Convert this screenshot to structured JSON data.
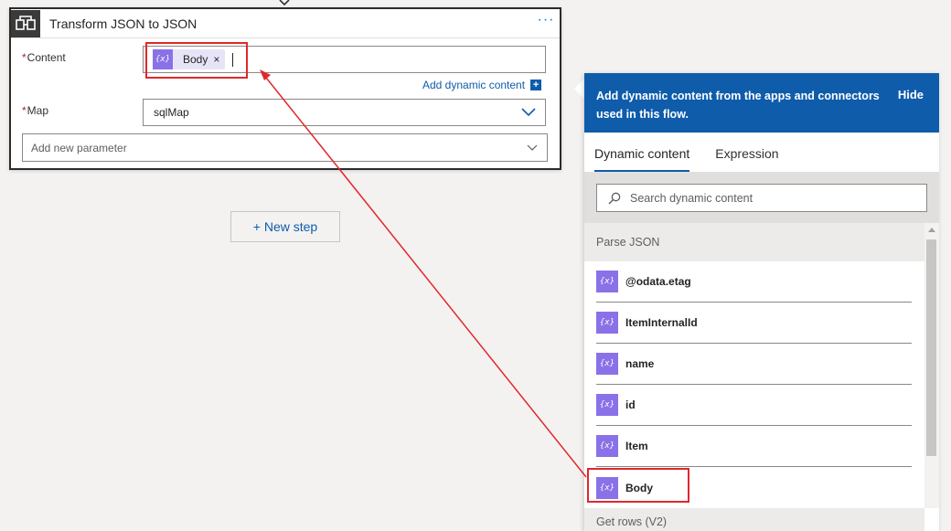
{
  "card": {
    "title": "Transform JSON to JSON",
    "more_label": "···",
    "content_field": {
      "required_mark": "*",
      "label": "Content",
      "token_icon": "{x}",
      "token_label": "Body",
      "token_close": "×"
    },
    "add_dynamic_label": "Add dynamic content",
    "add_dynamic_plus": "+",
    "map_field": {
      "required_mark": "*",
      "label": "Map",
      "value": "sqlMap"
    },
    "add_param_placeholder": "Add new parameter"
  },
  "new_step_label": "+ New step",
  "panel": {
    "header_message": "Add dynamic content from the apps and connectors used in this flow.",
    "hide_label": "Hide",
    "tabs": [
      {
        "label": "Dynamic content",
        "active": true
      },
      {
        "label": "Expression",
        "active": false
      }
    ],
    "search_placeholder": "Search dynamic content",
    "section_title": "Parse JSON",
    "item_icon": "{x}",
    "items": [
      {
        "label": "@odata.etag"
      },
      {
        "label": "ItemInternalId"
      },
      {
        "label": "name"
      },
      {
        "label": "id"
      },
      {
        "label": "Item"
      },
      {
        "label": "Body"
      }
    ],
    "next_section_title": "Get rows (V2)"
  },
  "colors": {
    "accent": "#0f5cab",
    "token": "#8a71e8",
    "highlight": "#e0282c"
  }
}
